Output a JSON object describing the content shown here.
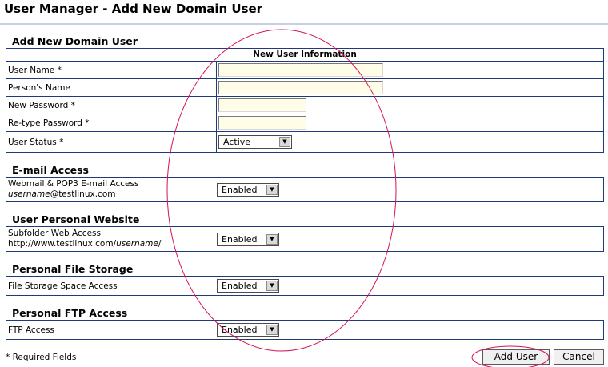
{
  "page": {
    "title": "User Manager - Add New Domain User"
  },
  "new_user": {
    "heading": "Add New Domain User",
    "table_header": "New User Information",
    "fields": {
      "user_name": {
        "label": "User Name *",
        "value": ""
      },
      "persons_name": {
        "label": "Person's Name",
        "value": ""
      },
      "new_password": {
        "label": "New Password *",
        "value": ""
      },
      "retype_password": {
        "label": "Re-type Password *",
        "value": ""
      },
      "user_status": {
        "label": "User Status *",
        "selected": "Active"
      }
    }
  },
  "email_access": {
    "heading": "E-mail Access",
    "label_line1": "Webmail & POP3 E-mail Access",
    "label_line2_italic": "username",
    "label_line2_rest": "@testlinux.com",
    "selected": "Enabled"
  },
  "personal_website": {
    "heading": "User Personal Website",
    "label_line1": "Subfolder Web Access",
    "label_line2_prefix": "http://www.testlinux.com/",
    "label_line2_italic": "username",
    "label_line2_suffix": "/",
    "selected": "Enabled"
  },
  "file_storage": {
    "heading": "Personal File Storage",
    "label": "File Storage Space Access",
    "selected": "Enabled"
  },
  "ftp_access": {
    "heading": "Personal FTP Access",
    "label": "FTP Access",
    "selected": "Enabled"
  },
  "footer": {
    "required_note": "* Required Fields",
    "add_user_label": "Add User",
    "cancel_label": "Cancel"
  },
  "colors": {
    "border": "#1f3a7a",
    "input_bg": "#fffde8",
    "annotation": "#d4145a"
  }
}
